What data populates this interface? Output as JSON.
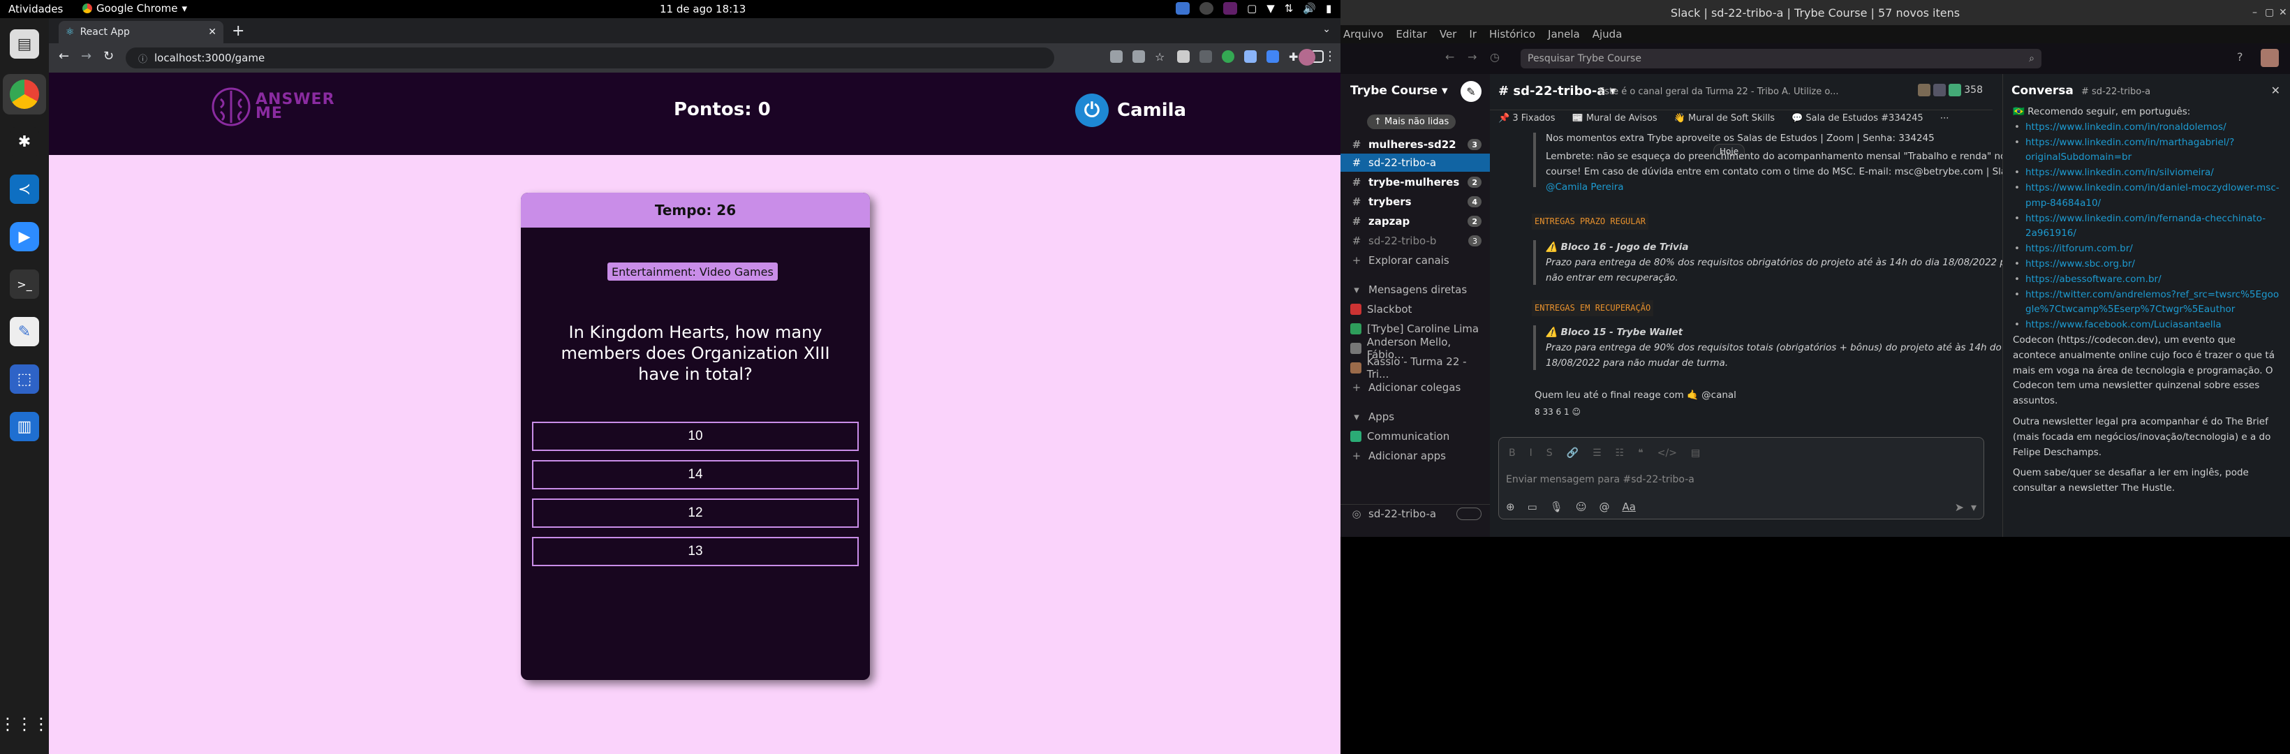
{
  "system": {
    "activities": "Atividades",
    "app_name": "Google Chrome",
    "clock": "11 de ago  18:13"
  },
  "browser": {
    "tab_title": "React App",
    "url": "localhost:3000/game"
  },
  "game": {
    "logo_line1": "ANSWER",
    "logo_line2": "ME",
    "score_label": "Pontos: 0",
    "player_name": "Camila",
    "timer": "Tempo: 26",
    "category": "Entertainment: Video Games",
    "question": "In Kingdom Hearts, how many members does Organization XIII have in total?",
    "answers": [
      "10",
      "14",
      "12",
      "13"
    ]
  },
  "slack": {
    "window_title": "Slack | sd-22-tribo-a | Trybe Course | 57 novos itens",
    "menu": [
      "Arquivo",
      "Editar",
      "Ver",
      "Ir",
      "Histórico",
      "Janela",
      "Ajuda"
    ],
    "search_placeholder": "Pesquisar Trybe Course",
    "workspace": "Trybe Course",
    "unread_pill": "↑ Mais não lidas",
    "channels": [
      {
        "name": "mulheres-sd22",
        "badge": "3",
        "bold": true
      },
      {
        "name": "sd-22-tribo-a",
        "badge": "",
        "active": true
      },
      {
        "name": "trybe-mulheres",
        "badge": "2",
        "bold": true
      },
      {
        "name": "trybers",
        "badge": "4",
        "bold": true
      },
      {
        "name": "zapzap",
        "badge": "2",
        "bold": true
      },
      {
        "name": "sd-22-tribo-b",
        "badge": "3",
        "bold": false
      }
    ],
    "explore": "Explorar canais",
    "dm_header": "Mensagens diretas",
    "dms": [
      "Slackbot",
      "[Trybe] Caroline Lima",
      "Anderson Mello, Fábio...",
      "Kassio - Turma 22 - Tri..."
    ],
    "add_colleagues": "Adicionar colegas",
    "apps_header": "Apps",
    "apps": [
      "Communication",
      "Adicionar apps"
    ],
    "footer_channel": "sd-22-tribo-a",
    "channel_name": "# sd-22-tribo-a",
    "topic": "Este é o canal geral da Turma 22 - Tribo A. Utilize o...",
    "member_count": "358",
    "bookmarks": [
      "3 Fixados",
      "Mural de Avisos",
      "Mural de Soft Skills",
      "Sala de Estudos #334245"
    ],
    "messages": {
      "line1": "Nos momentos extra Trybe aproveite os Salas de Estudos | Zoom | Senha: 334245",
      "hoje": "Hoje",
      "line2": "Lembrete: não se esqueça do preenchimento do acompanhamento mensal \"Trabalho e renda\" no",
      "line3": "course! Em caso de dúvida entre em contato com o time do MSC. E-mail: msc@betrybe.com | Slack:",
      "line4": "@Camila Pereira",
      "label1": "ENTREGAS PRAZO REGULAR",
      "b16_title": "Bloco 16 - Jogo de Trivia",
      "b16_l1": "Prazo para entrega de 80% dos requisitos obrigatórios do projeto até às 14h do dia 18/08/2022 para",
      "b16_l2": "não entrar em recuperação.",
      "label2": "ENTREGAS EM RECUPERAÇÃO",
      "b15_title": "Bloco 15 - Trybe Wallet",
      "b15_l1": "Prazo para entrega de 90% dos requisitos totais (obrigatórios + bônus) do projeto até às 14h do dia",
      "b15_l2": "18/08/2022  para não mudar de turma.",
      "final": "Quem leu até o final reage com 🤙 @canal",
      "reactions": "8   33   6   1"
    },
    "composer_placeholder": "Enviar mensagem para #sd-22-tribo-a",
    "thread_title": "Conversa",
    "thread_channel": "# sd-22-tribo-a",
    "thread_intro": "Recomendo seguir, em português:",
    "thread_links": [
      "https://www.linkedin.com/in/ronaldolemos/",
      "https://www.linkedin.com/in/marthagabriel/?originalSubdomain=br",
      "https://www.linkedin.com/in/silviomeira/",
      "https://www.linkedin.com/in/daniel-moczydlower-msc-pmp-84684a10/",
      "https://www.linkedin.com/in/fernanda-checchinato-2a961916/",
      "https://itforum.com.br/",
      "https://www.sbc.org.br/",
      "https://abessoftware.com.br/",
      "https://twitter.com/andrelemos?ref_src=twsrc%5Egoogle%7Ctwcamp%5Eserp%7Ctwgr%5Eauthor",
      "https://www.facebook.com/Luciasantaella"
    ],
    "thread_p1": "Codecon (https://codecon.dev), um evento que acontece anualmente online cujo foco é trazer o que tá mais em voga na área de tecnologia e programação. O Codecon tem uma newsletter quinzenal sobre esses assuntos.",
    "thread_p2": "Outra newsletter legal pra acompanhar é do The Brief (mais focada em negócios/inovação/tecnologia) e a do Felipe Deschamps.",
    "thread_p3": "Quem sabe/quer se desafiar a ler em inglês, pode consultar a newsletter The Hustle."
  }
}
